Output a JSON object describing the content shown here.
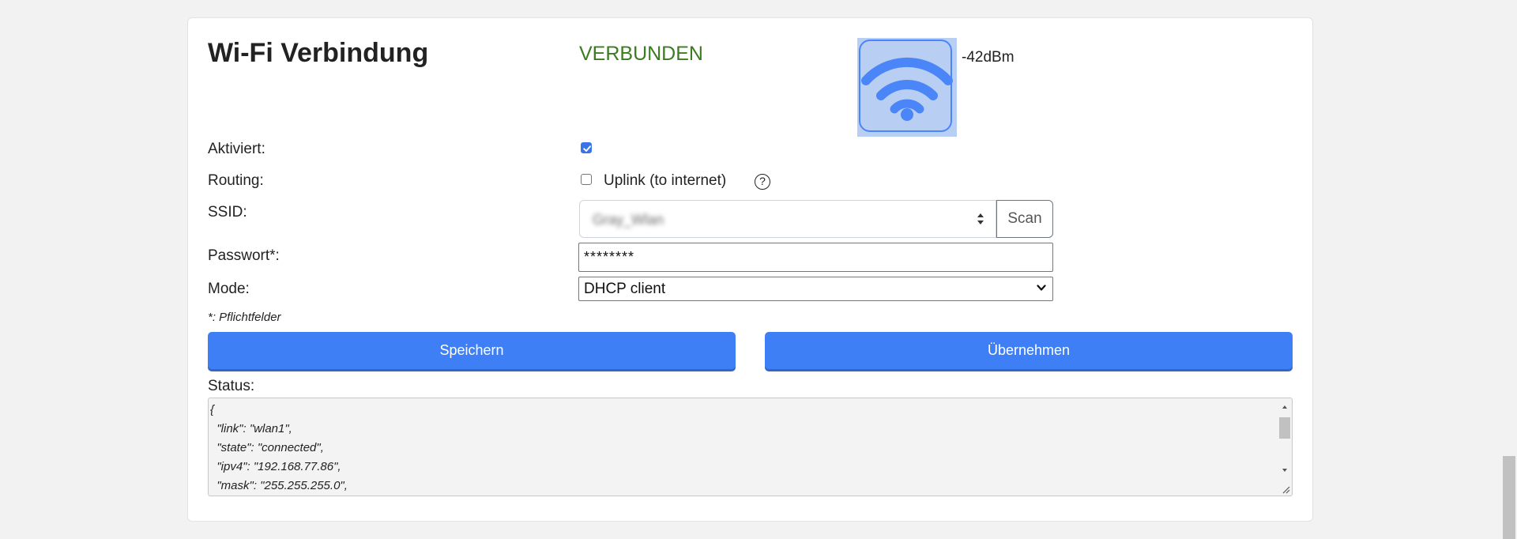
{
  "wifi": {
    "title": "Wi-Fi Verbindung",
    "state": "VERBUNDEN",
    "signal": "-42dBm",
    "icon": "wifi-signal-icon"
  },
  "form": {
    "enabled_label": "Aktiviert:",
    "enabled": true,
    "routing_label": "Routing:",
    "uplink_label": "Uplink (to internet)",
    "uplink": false,
    "help_glyph": "?",
    "ssid_label": "SSID:",
    "ssid_value": "Gray_Wlan",
    "scan_label": "Scan",
    "password_label": "Passwort*:",
    "password_value": "********",
    "mode_label": "Mode:",
    "mode_value": "DHCP client",
    "required_note": "*: Pflichtfelder"
  },
  "actions": {
    "save_label": "Speichern",
    "apply_label": "Übernehmen"
  },
  "status": {
    "label": "Status:",
    "text": "{\n  \"link\": \"wlan1\",\n  \"state\": \"connected\",\n  \"ipv4\": \"192.168.77.86\",\n  \"mask\": \"255.255.255.0\","
  },
  "colors": {
    "accent": "#3f7ff5",
    "connected": "#3a7d1e",
    "wifi_icon": "#4a86f7"
  }
}
